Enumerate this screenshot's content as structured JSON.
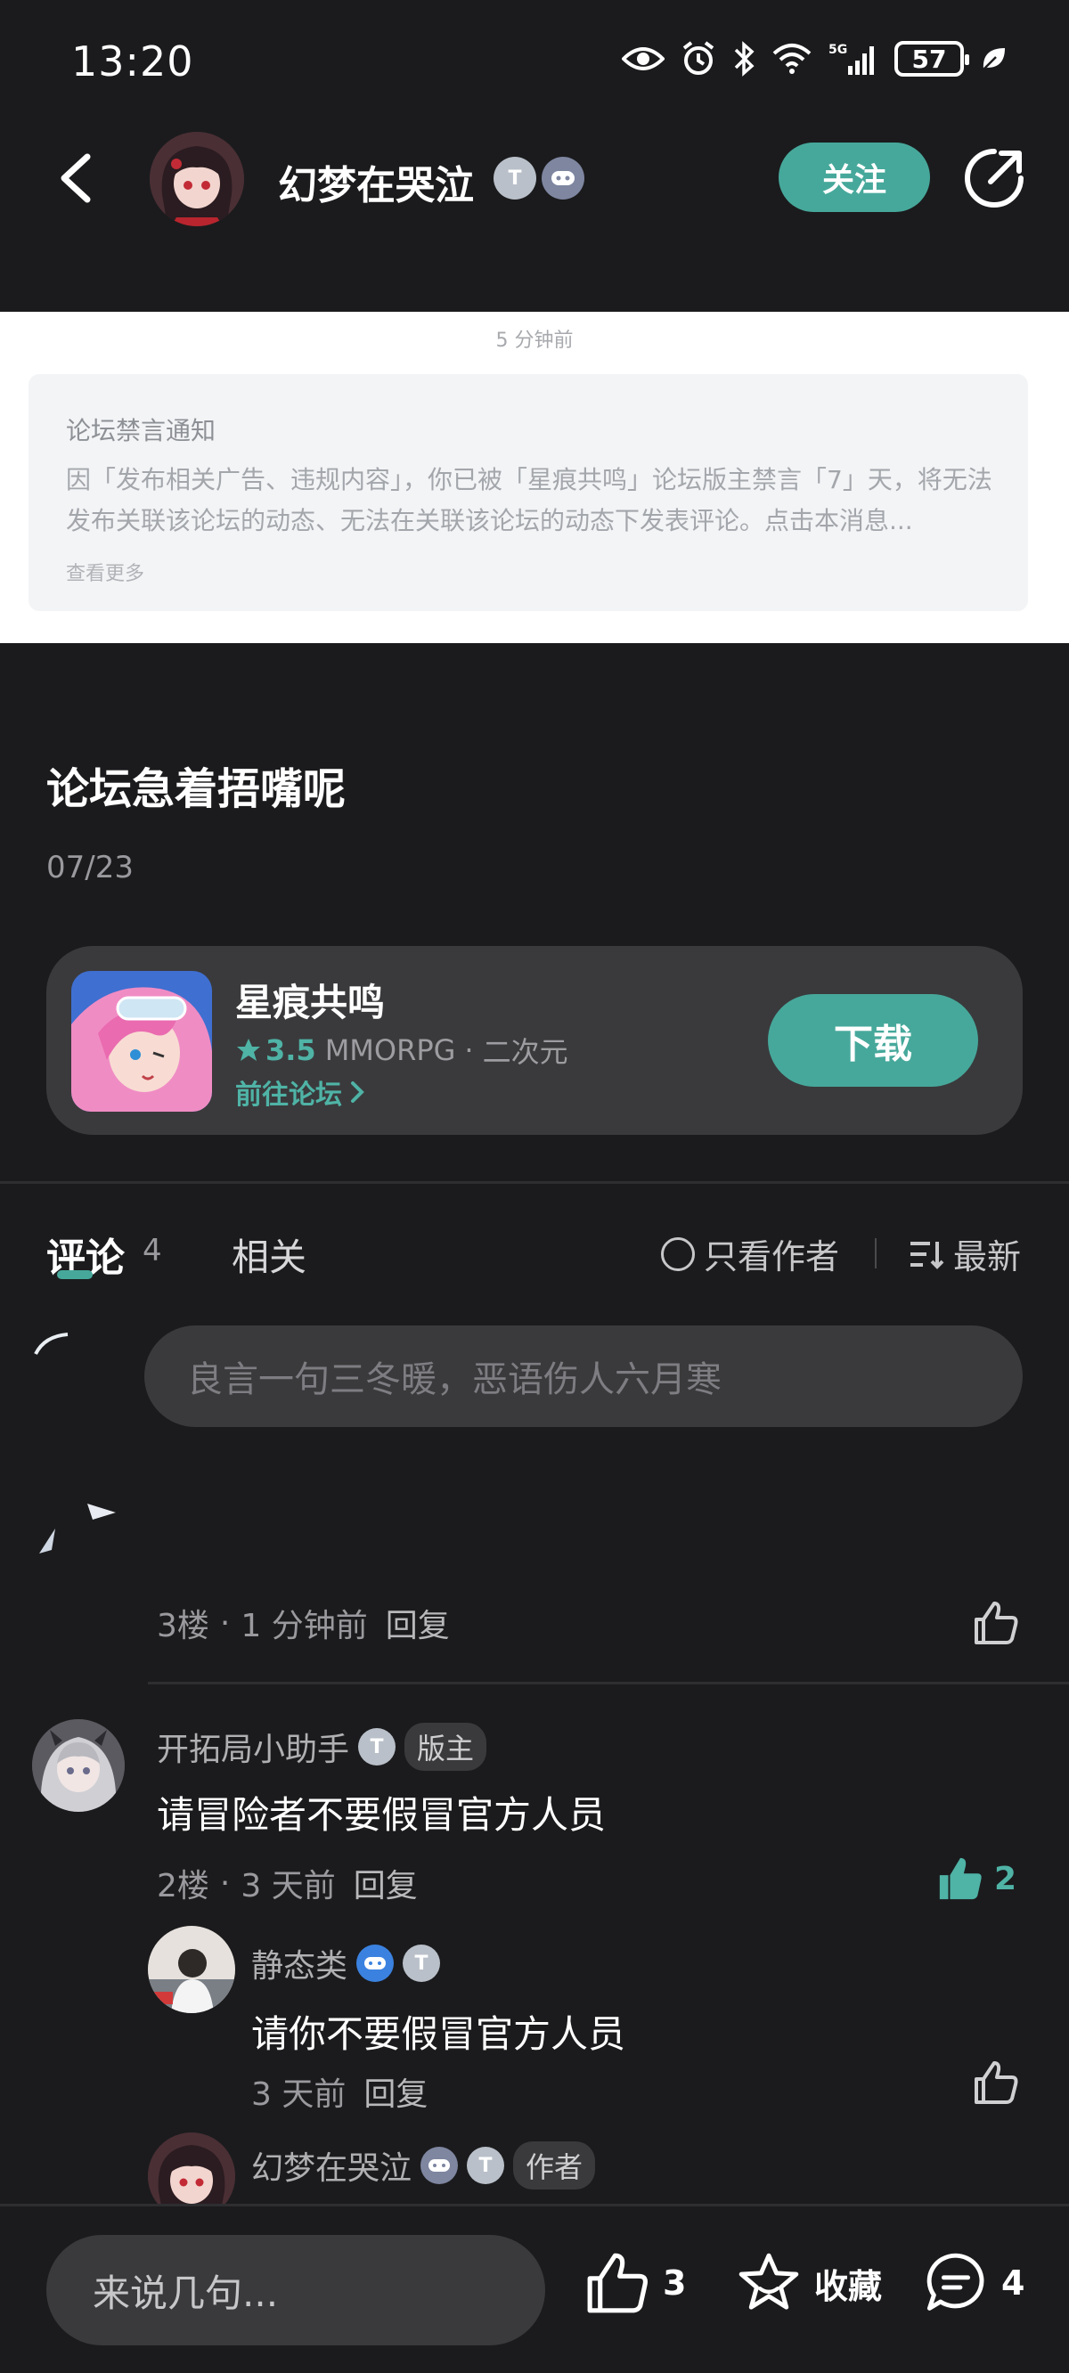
{
  "status": {
    "time": "13:20",
    "battery": "57",
    "network": "5G"
  },
  "header": {
    "username": "幻梦在哭泣",
    "follow_label": "关注"
  },
  "notice": {
    "time": "5 分钟前",
    "title": "论坛禁言通知",
    "body": "因「发布相关广告、违规内容」，你已被「星痕共鸣」论坛版主禁言「7」天，将无法发布关联该论坛的动态、无法在关联该论坛的动态下发表评论。点击本消息...",
    "more": "查看更多"
  },
  "post": {
    "title": "论坛急着捂嘴呢",
    "date": "07/23"
  },
  "game": {
    "name": "星痕共鸣",
    "rating": "3.5",
    "genre": "MMORPG",
    "dot": "·",
    "style": "二次元",
    "forum_link": "前往论坛",
    "download_label": "下载"
  },
  "tabs": {
    "comments_label": "评论",
    "comments_count": "4",
    "related_label": "相关",
    "author_only_label": "只看作者",
    "sort_label": "最新"
  },
  "comment_input_placeholder": "良言一句三冬暖，恶语伤人六月寒",
  "floor3": {
    "floor": "3楼",
    "dot": "·",
    "time": "1 分钟前",
    "reply": "回复"
  },
  "comments": [
    {
      "author": "开拓局小助手",
      "tag": "版主",
      "text": "请冒险者不要假冒官方人员",
      "floor": "2楼",
      "dot": "·",
      "time": "3 天前",
      "reply": "回复",
      "likes": "2"
    }
  ],
  "replies": [
    {
      "author": "静态类",
      "text": "请你不要假冒官方人员",
      "time": "3 天前",
      "reply": "回复"
    },
    {
      "author": "幻梦在哭泣",
      "tag": "作者"
    }
  ],
  "bottom": {
    "input_placeholder": "来说几句...",
    "likes": "3",
    "favorite_label": "收藏",
    "comments": "4"
  },
  "colors": {
    "accent": "#46a89b",
    "background": "#1b1b1d",
    "card": "#3a3a3c"
  }
}
